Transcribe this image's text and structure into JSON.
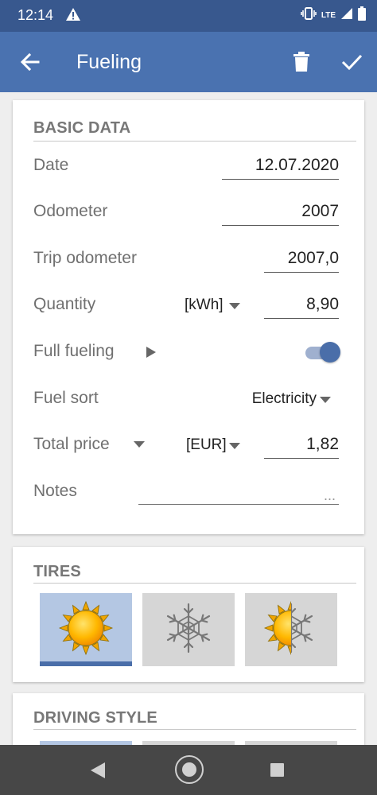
{
  "status_bar": {
    "time": "12:14",
    "network": "LTE",
    "icons": [
      "warning-icon",
      "vibrate-icon",
      "signal-icon",
      "battery-icon"
    ]
  },
  "app_bar": {
    "title": "Fueling",
    "icons": [
      "back-arrow-icon",
      "trash-icon",
      "check-icon"
    ]
  },
  "basic_data": {
    "section_title": "BASIC DATA",
    "date": {
      "label": "Date",
      "value": "12.07.2020"
    },
    "odometer": {
      "label": "Odometer",
      "value": "2007"
    },
    "trip_odometer": {
      "label": "Trip odometer",
      "value": "2007,0"
    },
    "quantity": {
      "label": "Quantity",
      "unit": "[kWh]",
      "value": "8,90"
    },
    "full_fueling": {
      "label": "Full fueling",
      "enabled": true
    },
    "fuel_sort": {
      "label": "Fuel sort",
      "value": "Electricity"
    },
    "total_price": {
      "label": "Total price",
      "currency": "[EUR]",
      "value": "1,82"
    },
    "notes": {
      "label": "Notes",
      "placeholder": "..."
    }
  },
  "tires": {
    "section_title": "TIRES",
    "options": [
      {
        "name": "summer",
        "icon": "sun-icon",
        "selected": true
      },
      {
        "name": "winter",
        "icon": "snowflake-icon",
        "selected": false
      },
      {
        "name": "all-season",
        "icon": "sun-snowflake-icon",
        "selected": false
      }
    ]
  },
  "driving_style": {
    "section_title": "DRIVING STYLE"
  },
  "colors": {
    "status_bar": "#38588e",
    "app_bar": "#4a72b0",
    "accent": "#4a6ea9",
    "selected_tile": "#b4c7e3",
    "tile": "#d6d6d6",
    "nav_bar": "#474747"
  }
}
